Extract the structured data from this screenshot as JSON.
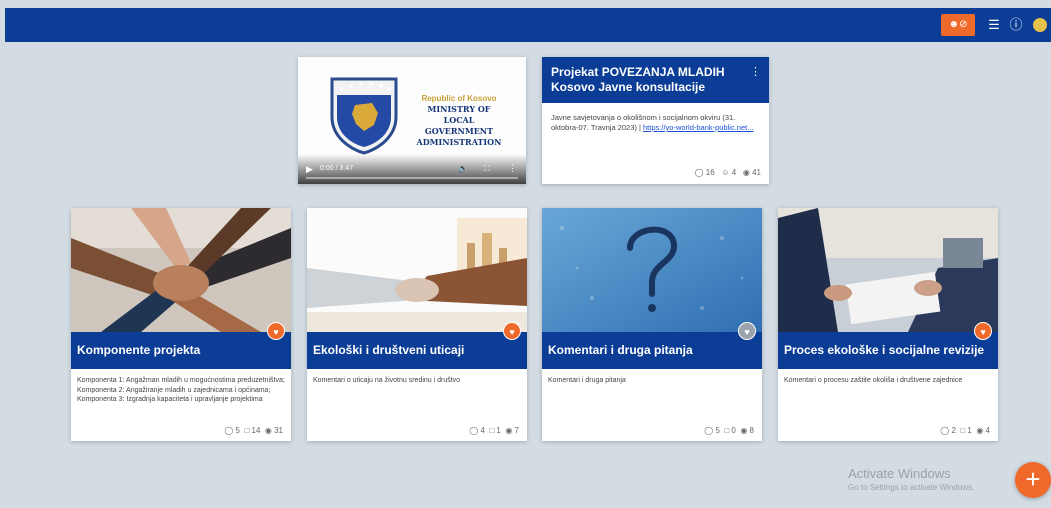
{
  "colors": {
    "brand_blue": "#0c3d96",
    "accent_orange": "#ef6a2a",
    "background": "#d3dbe3"
  },
  "header": {
    "icons": [
      "user-block-icon",
      "menu-icon",
      "help-icon",
      "avatar-icon"
    ]
  },
  "video_card": {
    "republic": "Republic of Kosovo",
    "ministry_lines": [
      "MINISTRY OF",
      "LOCAL",
      "GOVERNMENT",
      "ADMINISTRATION"
    ],
    "time": "0:00 / 3:47"
  },
  "project_card": {
    "title": "Projekat POVEZANJA MLADIH Kosovo Javne konsultacije",
    "description": "Javne savjetovanja o okolišnom i socijalnom okviru (31. oktobra-07. Travnja 2023) |",
    "link": "https://yo-world-bank-public.net...",
    "stats": {
      "comments": "16",
      "participants": "4",
      "views": "41"
    }
  },
  "topics": [
    {
      "title": "Komponente projekta",
      "description": "Komponenta 1: Angažman mladih u mogućnostima preduzetništva; Komponenta 2: Angažiranje mladih u zajednicama i općinama; Komponenta 3: Izgradnja kapaciteta i upravljanje projektima",
      "stats": {
        "ideas": "5",
        "comments": "14",
        "views": "31"
      }
    },
    {
      "title": "Ekološki i društveni uticaji",
      "description": "Komentari o uticaju na životnu sredinu i društvo",
      "stats": {
        "ideas": "4",
        "comments": "1",
        "views": "7"
      }
    },
    {
      "title": "Komentari i druga pitanja",
      "description": "Komentari i druga pitanja",
      "stats": {
        "ideas": "5",
        "comments": "0",
        "views": "8"
      }
    },
    {
      "title": "Proces ekološke i socijalne revizije",
      "description": "Komentari o procesu zaštite okoliša i društvene zajednice",
      "stats": {
        "ideas": "2",
        "comments": "1",
        "views": "4"
      }
    }
  ],
  "watermark": {
    "line1": "Activate Windows",
    "line2": "Go to Settings to activate Windows."
  }
}
